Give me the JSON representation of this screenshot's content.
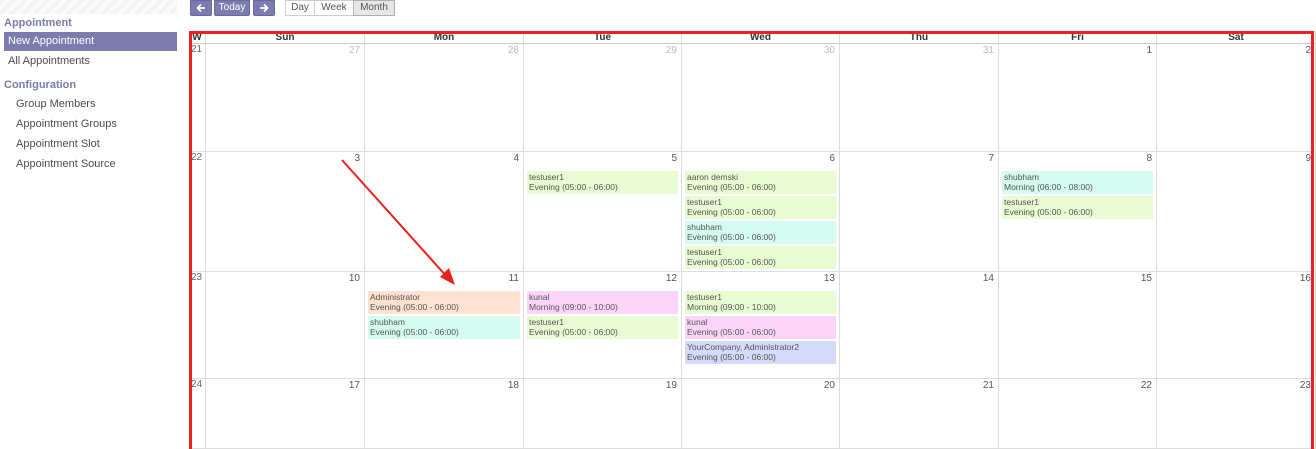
{
  "sidebar": {
    "sections": [
      {
        "title": "Appointment",
        "items": [
          {
            "label": "New Appointment",
            "active": true
          },
          {
            "label": "All Appointments",
            "active": false
          }
        ]
      },
      {
        "title": "Configuration",
        "items": [
          {
            "label": "Group Members"
          },
          {
            "label": "Appointment Groups"
          },
          {
            "label": "Appointment Slot"
          },
          {
            "label": "Appointment Source"
          }
        ]
      }
    ]
  },
  "toolbar": {
    "prev_icon": "arrow-left-icon",
    "today_label": "Today",
    "next_icon": "arrow-right-icon",
    "views": [
      "Day",
      "Week",
      "Month"
    ],
    "active_view": "Month"
  },
  "calendar": {
    "week_header": "W",
    "days": [
      "Sun",
      "Mon",
      "Tue",
      "Wed",
      "Thu",
      "Fri",
      "Sat"
    ],
    "weeks": [
      {
        "number": "21",
        "dates": [
          {
            "d": "27",
            "other": true
          },
          {
            "d": "28",
            "other": true
          },
          {
            "d": "29",
            "other": true
          },
          {
            "d": "30",
            "other": true
          },
          {
            "d": "31",
            "other": true
          },
          {
            "d": "1"
          },
          {
            "d": "2"
          }
        ]
      },
      {
        "number": "22",
        "dates": [
          {
            "d": "3"
          },
          {
            "d": "4"
          },
          {
            "d": "5",
            "events": [
              {
                "who": "testuser1",
                "when": "Evening (05:00 - 06:00)",
                "color": "#e9fbd2"
              }
            ]
          },
          {
            "d": "6",
            "events": [
              {
                "who": "aaron demski",
                "when": "Evening (05:00 - 06:00)",
                "color": "#e9fbd2"
              },
              {
                "who": "testuser1",
                "when": "Evening (05:00 - 06:00)",
                "color": "#e9fbd2"
              },
              {
                "who": "shubham",
                "when": "Evening (05:00 - 06:00)",
                "color": "#d5fbf0"
              },
              {
                "who": "testuser1",
                "when": "Evening (05:00 - 06:00)",
                "color": "#e9fbd2"
              }
            ]
          },
          {
            "d": "7"
          },
          {
            "d": "8",
            "events": [
              {
                "who": "shubham",
                "when": "Morning (06:00 - 08:00)",
                "color": "#d5fbf0"
              },
              {
                "who": "testuser1",
                "when": "Evening (05:00 - 06:00)",
                "color": "#e9fbd2"
              }
            ]
          },
          {
            "d": "9"
          }
        ]
      },
      {
        "number": "23",
        "dates": [
          {
            "d": "10"
          },
          {
            "d": "11",
            "events": [
              {
                "who": "Administrator",
                "when": "Evening (05:00 - 06:00)",
                "color": "#fde2cf"
              },
              {
                "who": "shubham",
                "when": "Evening (05:00 - 06:00)",
                "color": "#d5fbf0"
              }
            ]
          },
          {
            "d": "12",
            "events": [
              {
                "who": "kunal",
                "when": "Morning (09:00 - 10:00)",
                "color": "#fbd4f9"
              },
              {
                "who": "testuser1",
                "when": "Evening (05:00 - 06:00)",
                "color": "#e9fbd2"
              }
            ]
          },
          {
            "d": "13",
            "events": [
              {
                "who": "testuser1",
                "when": "Morning (09:00 - 10:00)",
                "color": "#e9fbd2"
              },
              {
                "who": "kunal",
                "when": "Evening (05:00 - 06:00)",
                "color": "#fbd4f9"
              },
              {
                "who": "YourCompany, Administrator2",
                "when": "Evening (05:00 - 06:00)",
                "color": "#d5daf8"
              }
            ]
          },
          {
            "d": "14"
          },
          {
            "d": "15"
          },
          {
            "d": "16"
          }
        ]
      },
      {
        "number": "24",
        "dates": [
          {
            "d": "17"
          },
          {
            "d": "18"
          },
          {
            "d": "19"
          },
          {
            "d": "20"
          },
          {
            "d": "21"
          },
          {
            "d": "22"
          },
          {
            "d": "23"
          }
        ]
      }
    ]
  },
  "annotation": {
    "box_color": "#e8221e",
    "arrow_color": "#e8221e"
  }
}
